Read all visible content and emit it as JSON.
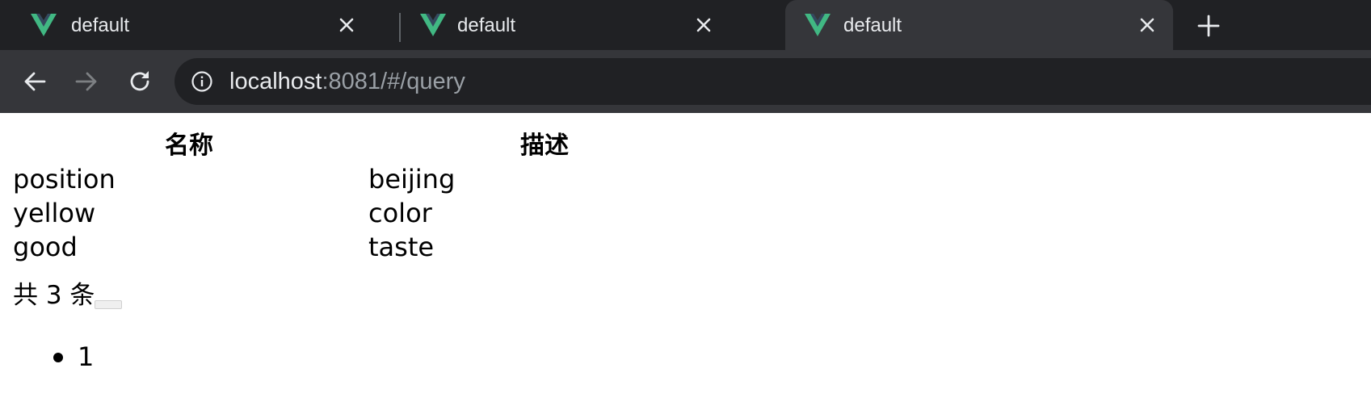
{
  "browser": {
    "tabs": [
      {
        "title": "default",
        "active": false
      },
      {
        "title": "default",
        "active": false
      },
      {
        "title": "default",
        "active": true
      }
    ],
    "address": {
      "host": "localhost",
      "path": ":8081/#/query"
    },
    "icons": {
      "tab_logo": "vue-logo-icon",
      "tab_close": "close-icon",
      "new_tab": "plus-icon",
      "back": "arrow-left-icon",
      "forward": "arrow-right-icon",
      "reload": "reload-icon",
      "site_info": "info-icon"
    },
    "colors": {
      "tabstrip": "#202124",
      "active_tab": "#35363a",
      "vue_green": "#41b883",
      "vue_dark": "#34495e"
    }
  },
  "table": {
    "headers": [
      "名称",
      "描述"
    ],
    "rows": [
      [
        "position",
        "beijing"
      ],
      [
        "yellow",
        "color"
      ],
      [
        "good",
        "taste"
      ]
    ]
  },
  "pagination": {
    "total_text": "共 3 条",
    "pages": [
      "1"
    ]
  }
}
